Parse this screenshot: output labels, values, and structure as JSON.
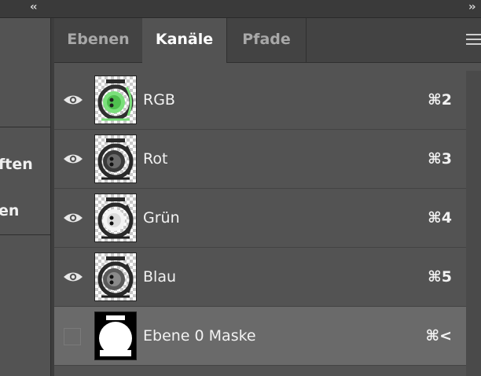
{
  "topbar": {
    "collapse_left": "‹‹",
    "collapse_right": "››"
  },
  "left_panel": {
    "labels": [
      "ften",
      "en"
    ]
  },
  "panel": {
    "tabs": [
      {
        "label": "Ebenen",
        "active": false
      },
      {
        "label": "Kanäle",
        "active": true
      },
      {
        "label": "Pfade",
        "active": false
      }
    ],
    "menu_icon": "hamburger-menu-icon"
  },
  "channels": [
    {
      "name": "RGB",
      "shortcut": "⌘2",
      "visible": true,
      "thumb": "rgb"
    },
    {
      "name": "Rot",
      "shortcut": "⌘3",
      "visible": true,
      "thumb": "gray"
    },
    {
      "name": "Grün",
      "shortcut": "⌘4",
      "visible": true,
      "thumb": "gray"
    },
    {
      "name": "Blau",
      "shortcut": "⌘5",
      "visible": true,
      "thumb": "gray"
    },
    {
      "name": "Ebene 0 Maske",
      "shortcut": "⌘<",
      "visible": false,
      "thumb": "mask",
      "selected": true
    }
  ],
  "colors": {
    "panel_bg": "#535353",
    "tab_bar": "#434343",
    "selected_row": "#6a6a6a",
    "rgb_accent": "#7be07b"
  }
}
